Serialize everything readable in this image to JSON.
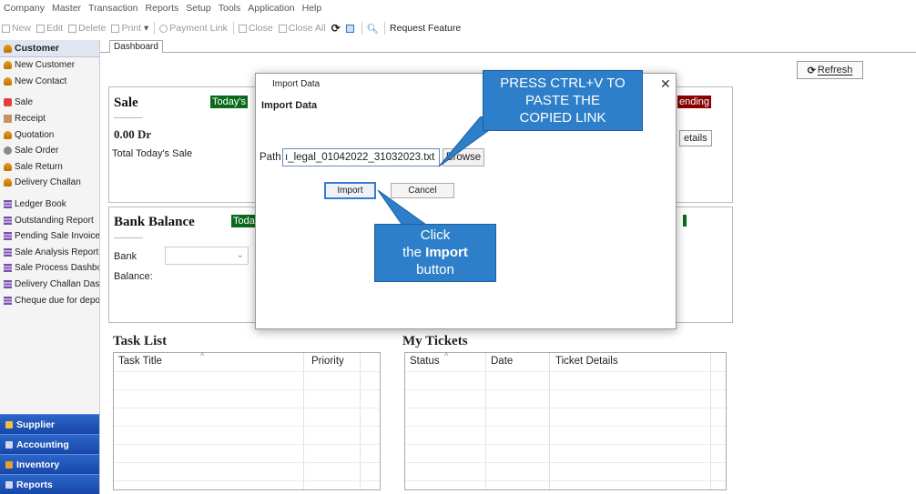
{
  "menubar": [
    "Company",
    "Master",
    "Transaction",
    "Reports",
    "Setup",
    "Tools",
    "Application",
    "Help"
  ],
  "toolbar": {
    "new": "New",
    "edit": "Edit",
    "delete": "Delete",
    "print": "Print",
    "payment_link": "Payment Link",
    "close": "Close",
    "close_all": "Close All",
    "request_feature": "Request Feature"
  },
  "sidebar": {
    "header": "Customer",
    "items": [
      {
        "label": "New Customer",
        "icon": "person-icon"
      },
      {
        "label": "New Contact",
        "icon": "person-icon"
      },
      {
        "label": "Sale",
        "icon": "sale-icon"
      },
      {
        "label": "Receipt",
        "icon": "receipt-icon"
      },
      {
        "label": "Quotation",
        "icon": "person-icon"
      },
      {
        "label": "Sale Order",
        "icon": "order-icon"
      },
      {
        "label": "Sale Return",
        "icon": "person-icon"
      },
      {
        "label": "Delivery Challan",
        "icon": "person-icon"
      },
      {
        "label": "Ledger Book",
        "icon": "report-icon"
      },
      {
        "label": "Outstanding Report",
        "icon": "report-icon"
      },
      {
        "label": "Pending Sale Invoices",
        "icon": "report-icon"
      },
      {
        "label": "Sale Analysis Report",
        "icon": "report-icon"
      },
      {
        "label": "Sale Process Dashboa",
        "icon": "report-icon"
      },
      {
        "label": "Delivery Challan Dashl",
        "icon": "report-icon"
      },
      {
        "label": "Cheque due for depos",
        "icon": "report-icon"
      }
    ],
    "bottom": [
      "Supplier",
      "Accounting",
      "Inventory",
      "Reports"
    ]
  },
  "tab": "Dashboard",
  "refresh_label": "Refresh",
  "sale_card": {
    "title": "Sale",
    "badge": "Today's",
    "amount": "0.00 Dr",
    "label": "Total Today's Sale",
    "pending_badge": "ending",
    "details_label": "etails"
  },
  "bank_card": {
    "title": "Bank Balance",
    "badge": "Toda",
    "bank_label": "Bank",
    "balance_label": "Balance:"
  },
  "task_list": {
    "title": "Task List",
    "columns": [
      "Task Title",
      "Priority"
    ]
  },
  "tickets": {
    "title": "My Tickets",
    "columns": [
      "Status",
      "Date",
      "Ticket Details"
    ]
  },
  "dialog": {
    "caption": "Import Data",
    "heading": "Import Data",
    "path_label": "Path",
    "path_value": "ı_legal_01042022_31032023.txt",
    "browse": "Browse",
    "import": "Import",
    "cancel": "Cancel"
  },
  "callouts": {
    "paste": [
      "PRESS CTRL+V TO",
      "PASTE THE",
      "COPIED LINK"
    ],
    "click_line1": "Click",
    "click_the": "the ",
    "click_bold": "Import",
    "click_line3": "button"
  },
  "colors": {
    "callout": "#2e7fc9",
    "sidebar_bottom": "#1f55b8",
    "green_badge": "#0a6a1a",
    "red_badge": "#8a0000"
  }
}
